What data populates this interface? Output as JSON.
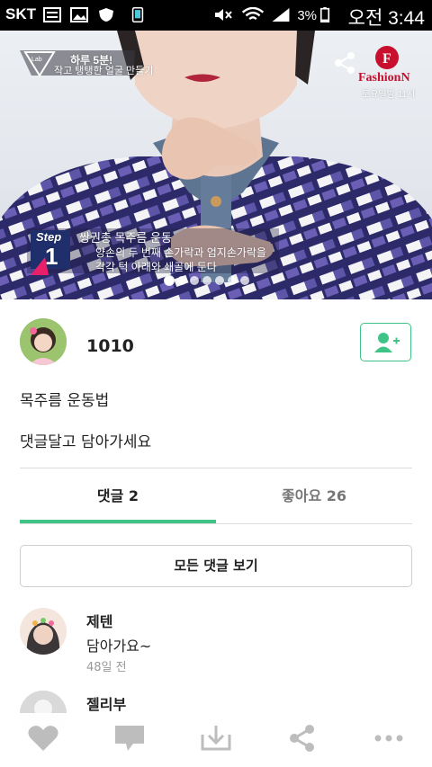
{
  "status_bar": {
    "carrier": "SKT",
    "battery": "3%",
    "time": "오전 3:44"
  },
  "hero": {
    "corner_badge": "하루 5분!",
    "corner_subtitle": "작고 탱탱한 얼굴 만들기",
    "brand_name": "FashionN",
    "brand_schedule": "토요일밤 11시",
    "step_label": "Step",
    "step_number": "1",
    "caption_title": "쌍권총 목주름 운동",
    "caption_line1": "양손의 두 번째 손가락과 엄지손가락을",
    "caption_line2": "각각 턱 아래와 쇄골에 둔다",
    "slide_count": 7,
    "active_slide": 1
  },
  "profile": {
    "username": "1010"
  },
  "post": {
    "line1": "목주름 운동법",
    "line2": "댓글달고 담아가세요"
  },
  "tabs": {
    "comments": "댓글 2",
    "likes": "좋아요 26"
  },
  "buttons": {
    "view_all_comments": "모든 댓글 보기"
  },
  "comments": [
    {
      "name": "제텐",
      "text": "담아가요~",
      "time": "48일 전"
    },
    {
      "name": "젤리부"
    }
  ],
  "colors": {
    "accent": "#3ec487"
  }
}
